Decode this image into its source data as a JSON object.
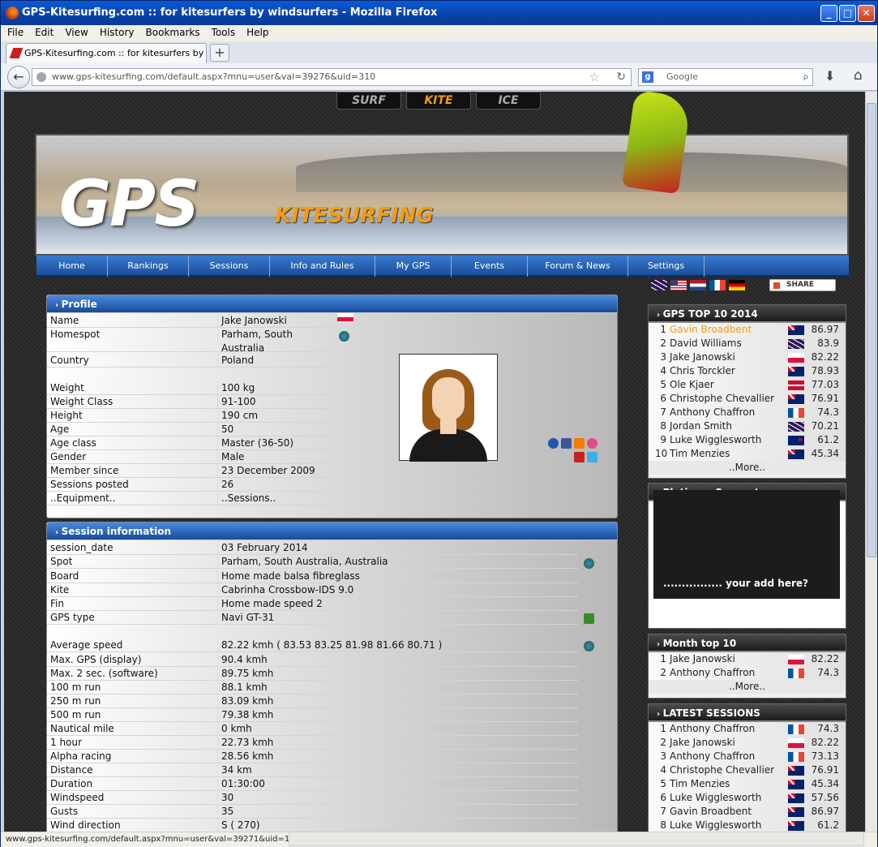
{
  "browser": {
    "title": "GPS-Kitesurfing.com :: for kitesurfers by windsurfers - Mozilla Firefox",
    "menu": [
      "File",
      "Edit",
      "View",
      "History",
      "Bookmarks",
      "Tools",
      "Help"
    ],
    "tab_title": "GPS-Kitesurfing.com :: for kitesurfers by win...",
    "url": "www.gps-kitesurfing.com/default.aspx?mnu=user&val=39276&uid=310",
    "search_placeholder": "Google",
    "status_url": "www.gps-kitesurfing.com/default.aspx?mnu=user&val=39271&uid=181"
  },
  "site": {
    "section_tabs": [
      "SURF",
      "KITE",
      "ICE"
    ],
    "logo_main": "GPS",
    "logo_sub": "KITESURFING",
    "nav": [
      "Home",
      "Rankings",
      "Sessions",
      "Info and Rules",
      "My GPS",
      "Events",
      "Forum & News",
      "Settings"
    ],
    "share_label": "SHARE"
  },
  "profile": {
    "heading": "Profile",
    "rows": [
      {
        "k": "Name",
        "v": "Jake Janowski"
      },
      {
        "k": "Homespot",
        "v": "Parham, South Australia"
      },
      {
        "k": "Country",
        "v": "Poland"
      },
      {
        "k": "Weight",
        "v": "100 kg"
      },
      {
        "k": "Weight Class",
        "v": "91-100"
      },
      {
        "k": "Height",
        "v": "190 cm"
      },
      {
        "k": "Age",
        "v": "50"
      },
      {
        "k": "Age class",
        "v": "Master (36-50)"
      },
      {
        "k": "Gender",
        "v": "Male"
      },
      {
        "k": "Member since",
        "v": "23 December 2009"
      },
      {
        "k": "Sessions posted",
        "v": "26"
      },
      {
        "k": "..Equipment..",
        "v": "..Sessions.."
      }
    ]
  },
  "session": {
    "heading": "Session information",
    "rows": [
      {
        "k": "session_date",
        "v": "03 February 2014"
      },
      {
        "k": "Spot",
        "v": "Parham, South Australia, Australia"
      },
      {
        "k": "Board",
        "v": "Home made balsa fibreglass"
      },
      {
        "k": "Kite",
        "v": "Cabrinha Crossbow-IDS 9.0"
      },
      {
        "k": "Fin",
        "v": "Home made speed 2"
      },
      {
        "k": "GPS type",
        "v": "Navi GT-31"
      },
      {
        "k": "Average speed",
        "v": "82.22 kmh ( 83.53 83.25 81.98 81.66 80.71 )"
      },
      {
        "k": "Max. GPS (display)",
        "v": "90.4 kmh"
      },
      {
        "k": "Max. 2 sec. (software)",
        "v": "89.75 kmh"
      },
      {
        "k": "100 m run",
        "v": "88.1 kmh"
      },
      {
        "k": "250 m run",
        "v": "83.09 kmh"
      },
      {
        "k": "500 m run",
        "v": "79.38 kmh"
      },
      {
        "k": "Nautical mile",
        "v": "0 kmh"
      },
      {
        "k": "1 hour",
        "v": "22.73 kmh"
      },
      {
        "k": "Alpha racing",
        "v": "28.56 kmh"
      },
      {
        "k": "Distance",
        "v": "34 km"
      },
      {
        "k": "Duration",
        "v": "01:30:00"
      },
      {
        "k": "Windspeed",
        "v": "30"
      },
      {
        "k": "Gusts",
        "v": "35"
      },
      {
        "k": "Wind direction",
        "v": "S ( 270)"
      }
    ]
  },
  "top10": {
    "heading": "GPS TOP 10 2014",
    "rows": [
      {
        "n": "1",
        "name": "Gavin Broadbent",
        "flag": "au",
        "score": "86.97"
      },
      {
        "n": "2",
        "name": "David Williams",
        "flag": "gb",
        "score": "83.9"
      },
      {
        "n": "3",
        "name": "Jake Janowski",
        "flag": "pl",
        "score": "82.22"
      },
      {
        "n": "4",
        "name": "Chris Torckler",
        "flag": "au",
        "score": "78.93"
      },
      {
        "n": "5",
        "name": "Ole Kjaer",
        "flag": "dk",
        "score": "77.03"
      },
      {
        "n": "6",
        "name": "Christophe Chevallier",
        "flag": "au",
        "score": "76.91"
      },
      {
        "n": "7",
        "name": "Anthony Chaffron",
        "flag": "fr",
        "score": "74.3"
      },
      {
        "n": "8",
        "name": "Jordan Smith",
        "flag": "gb",
        "score": "70.21"
      },
      {
        "n": "9",
        "name": "Luke Wigglesworth",
        "flag": "nz",
        "score": "61.2"
      },
      {
        "n": "10",
        "name": "Tim Menzies",
        "flag": "au",
        "score": "45.34"
      }
    ],
    "more": "..More.."
  },
  "platinum": {
    "heading": "Platinum Supporter",
    "ad_text": "................ your add here?"
  },
  "month": {
    "heading": "Month top 10",
    "rows": [
      {
        "n": "1",
        "name": "Jake Janowski",
        "flag": "pl",
        "score": "82.22"
      },
      {
        "n": "2",
        "name": "Anthony Chaffron",
        "flag": "fr",
        "score": "74.3"
      }
    ],
    "more": "..More.."
  },
  "latest": {
    "heading": "LATEST SESSIONS",
    "rows": [
      {
        "n": "1",
        "name": "Anthony Chaffron",
        "flag": "fr",
        "score": "74.3"
      },
      {
        "n": "2",
        "name": "Jake Janowski",
        "flag": "pl",
        "score": "82.22"
      },
      {
        "n": "3",
        "name": "Anthony Chaffron",
        "flag": "fr",
        "score": "73.13"
      },
      {
        "n": "4",
        "name": "Christophe Chevallier",
        "flag": "au",
        "score": "76.91"
      },
      {
        "n": "5",
        "name": "Tim Menzies",
        "flag": "au",
        "score": "45.34"
      },
      {
        "n": "6",
        "name": "Luke Wigglesworth",
        "flag": "au",
        "score": "57.56"
      },
      {
        "n": "7",
        "name": "Gavin Broadbent",
        "flag": "au",
        "score": "86.97"
      },
      {
        "n": "8",
        "name": "Luke Wigglesworth",
        "flag": "au",
        "score": "61.2"
      }
    ]
  },
  "colors": {
    "accent": "#f39c12",
    "nav": "#1a4f9a"
  }
}
